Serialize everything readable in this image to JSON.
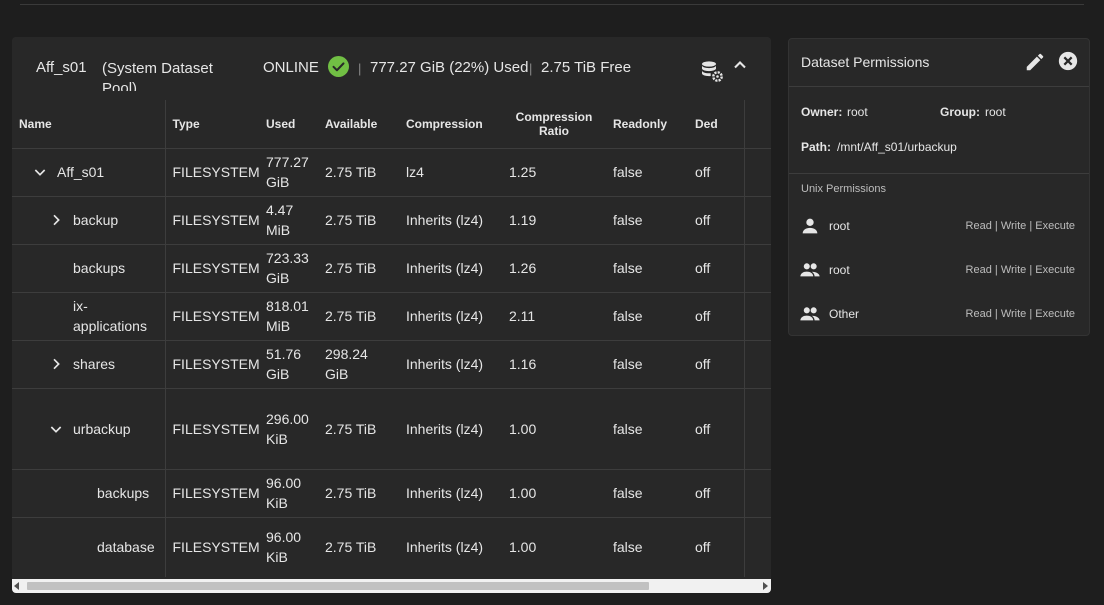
{
  "pool": {
    "name": "Aff_s01",
    "description": "(System Dataset Pool)",
    "status": "ONLINE",
    "used": "777.27 GiB (22%) Used",
    "free": "2.75 TiB Free",
    "separator": "|"
  },
  "table": {
    "headers": {
      "name": "Name",
      "type": "Type",
      "used": "Used",
      "available": "Available",
      "compression": "Compression",
      "ratio_line1": "Compression",
      "ratio_line2": "Ratio",
      "readonly": "Readonly",
      "dedup": "Ded"
    },
    "rows": [
      {
        "name": "Aff_s01",
        "type": "FILESYSTEM",
        "used": "777.27 GiB",
        "available": "2.75 TiB",
        "compression": "lz4",
        "ratio": "1.25",
        "readonly": "false",
        "dedup": "off"
      },
      {
        "name": "backup",
        "type": "FILESYSTEM",
        "used": "4.47 MiB",
        "available": "2.75 TiB",
        "compression": "Inherits (lz4)",
        "ratio": "1.19",
        "readonly": "false",
        "dedup": "off"
      },
      {
        "name": "backups",
        "type": "FILESYSTEM",
        "used": "723.33 GiB",
        "available": "2.75 TiB",
        "compression": "Inherits (lz4)",
        "ratio": "1.26",
        "readonly": "false",
        "dedup": "off"
      },
      {
        "name": "ix-applications",
        "type": "FILESYSTEM",
        "used": "818.01 MiB",
        "available": "2.75 TiB",
        "compression": "Inherits (lz4)",
        "ratio": "2.11",
        "readonly": "false",
        "dedup": "off"
      },
      {
        "name": "shares",
        "type": "FILESYSTEM",
        "used": "51.76 GiB",
        "available": "298.24 GiB",
        "compression": "Inherits (lz4)",
        "ratio": "1.16",
        "readonly": "false",
        "dedup": "off"
      },
      {
        "name": "urbackup",
        "type": "FILESYSTEM",
        "used": "296.00 KiB",
        "available": "2.75 TiB",
        "compression": "Inherits (lz4)",
        "ratio": "1.00",
        "readonly": "false",
        "dedup": "off"
      },
      {
        "name": "backups",
        "type": "FILESYSTEM",
        "used": "96.00 KiB",
        "available": "2.75 TiB",
        "compression": "Inherits (lz4)",
        "ratio": "1.00",
        "readonly": "false",
        "dedup": "off"
      },
      {
        "name": "database",
        "type": "FILESYSTEM",
        "used": "96.00 KiB",
        "available": "2.75 TiB",
        "compression": "Inherits (lz4)",
        "ratio": "1.00",
        "readonly": "false",
        "dedup": "off"
      }
    ]
  },
  "permissions": {
    "title": "Dataset Permissions",
    "owner_label": "Owner:",
    "owner_value": "root",
    "group_label": "Group:",
    "group_value": "root",
    "path_label": "Path:",
    "path_value": "/mnt/Aff_s01/urbackup",
    "unix_title": "Unix Permissions",
    "unix": [
      {
        "icon": "person-icon",
        "name": "root",
        "perms": "Read | Write | Execute"
      },
      {
        "icon": "group-icon",
        "name": "root",
        "perms": "Read | Write | Execute"
      },
      {
        "icon": "group-icon",
        "name": "Other",
        "perms": "Read | Write | Execute"
      }
    ]
  },
  "colors": {
    "background": "#1e1e1e",
    "card": "#282828",
    "online_check": "#71bf44",
    "divider": "#3d3d3d"
  }
}
